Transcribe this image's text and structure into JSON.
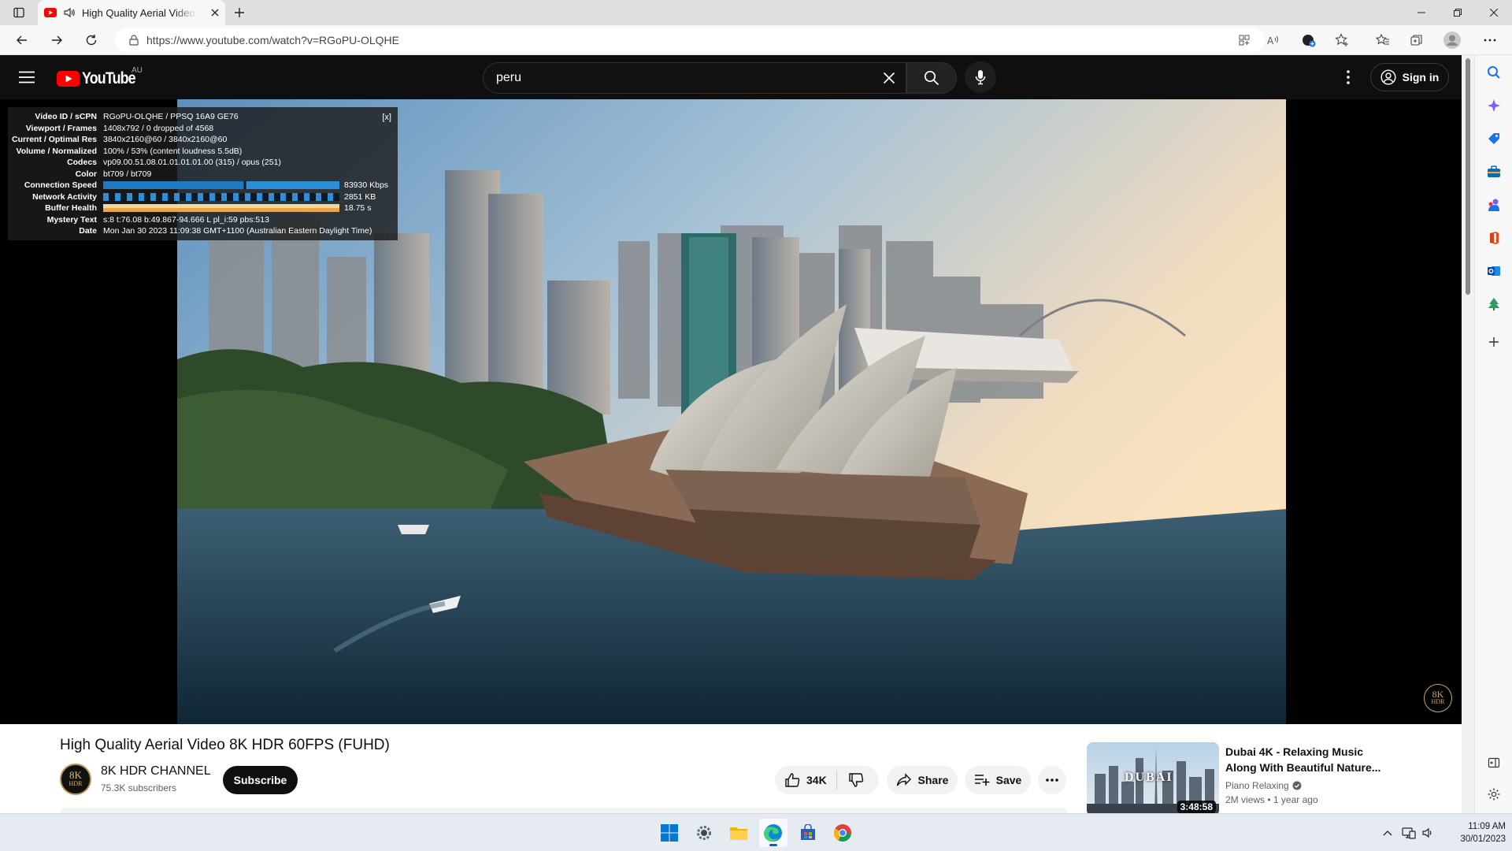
{
  "browser": {
    "tab_title": "High Quality Aerial Video 8K HDR 60FPS (FUHD)",
    "url": "https://www.youtube.com/watch?v=RGoPU-OLQHE"
  },
  "masthead": {
    "logo_text": "YouTube",
    "region": "AU",
    "search_value": "peru",
    "signin_label": "Sign in"
  },
  "stats": {
    "close_label": "[x]",
    "rows": [
      {
        "label": "Video ID / sCPN",
        "value": "RGoPU-OLQHE  /  PPSQ  16A9  GE76"
      },
      {
        "label": "Viewport / Frames",
        "value": "1408x792 / 0 dropped of 4568"
      },
      {
        "label": "Current / Optimal Res",
        "value": "3840x2160@60 / 3840x2160@60"
      },
      {
        "label": "Volume / Normalized",
        "value": "100% / 53% (content loudness 5.5dB)"
      },
      {
        "label": "Codecs",
        "value": "vp09.00.51.08.01.01.01.01.00 (315) / opus (251)"
      },
      {
        "label": "Color",
        "value": "bt709 / bt709"
      },
      {
        "label": "Connection Speed",
        "value": "83930 Kbps"
      },
      {
        "label": "Network Activity",
        "value": "2851 KB"
      },
      {
        "label": "Buffer Health",
        "value": "18.75 s"
      },
      {
        "label": "Mystery Text",
        "value": "s:8 t:76.08 b:49.867-94.666 L pl_i:59 pbs:513"
      },
      {
        "label": "Date",
        "value": "Mon Jan 30 2023 11:09:38 GMT+1100 (Australian Eastern Daylight Time)"
      }
    ]
  },
  "watermark": {
    "line1": "8K",
    "line2": "HDR"
  },
  "video": {
    "title": "High Quality Aerial Video 8K HDR 60FPS (FUHD)",
    "channel": "8K HDR CHANNEL",
    "subscribers": "75.3K subscribers",
    "subscribe_label": "Subscribe",
    "likes": "34K",
    "share_label": "Share",
    "save_label": "Save",
    "avatar_line1": "8K",
    "avatar_line2": "HDR"
  },
  "recommended": {
    "title": "Dubai 4K - Relaxing Music Along With Beautiful Nature...",
    "thumb_text": "DUBAI",
    "channel": "Piano Relaxing",
    "views": "2M views",
    "age": "1 year ago",
    "duration": "3:48:58"
  },
  "taskbar": {
    "time": "11:09 AM",
    "date": "30/01/2023"
  },
  "colors": {
    "yt_red": "#ff0000",
    "masthead_bg": "#0f0f0f",
    "accent_blue": "#0067c0"
  }
}
